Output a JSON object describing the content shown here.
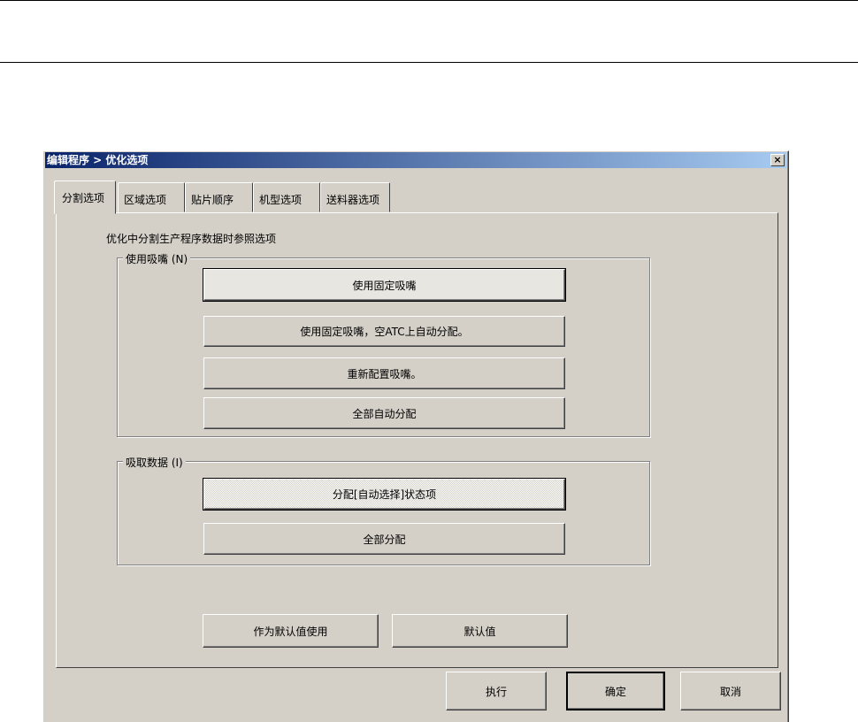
{
  "window": {
    "title": "编辑程序 > 优化选项",
    "close_label": "×"
  },
  "tabs": [
    {
      "label": "分割选项"
    },
    {
      "label": "区域选项"
    },
    {
      "label": "贴片顺序"
    },
    {
      "label": "机型选项"
    },
    {
      "label": "送料器选项"
    }
  ],
  "panel": {
    "description": "优化中分割生产程序数据时参照选项"
  },
  "nozzle_group": {
    "label": "使用吸嘴 (N)",
    "buttons": [
      "使用固定吸嘴",
      "使用固定吸嘴，空ATC上自动分配。",
      "重新配置吸嘴。",
      "全部自动分配"
    ]
  },
  "pickup_group": {
    "label": "吸取数据 (I)",
    "buttons": [
      "分配[自动选择]状态项",
      "全部分配"
    ]
  },
  "defaults": {
    "use_as_default": "作为默认值使用",
    "default": "默认值"
  },
  "footer": {
    "execute": "执行",
    "ok": "确定",
    "cancel": "取消"
  }
}
